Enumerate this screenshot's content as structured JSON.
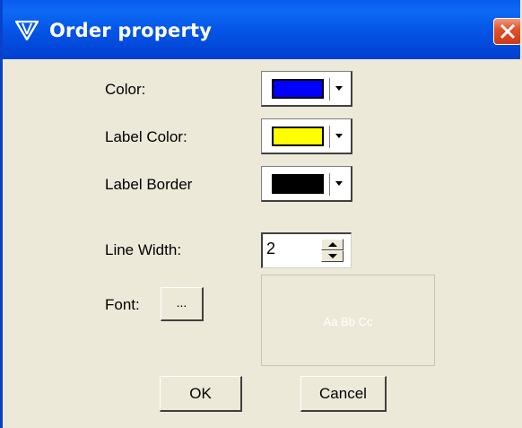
{
  "window": {
    "title": "Order property"
  },
  "colors": {
    "title_bar": "#0453e4",
    "close_button": "#e2522c",
    "dialog_bg": "#ece9d8"
  },
  "icons": {
    "app": "v-triangle-icon",
    "close": "close-x-icon",
    "dropdown": "chevron-down-icon"
  },
  "fields": {
    "color": {
      "label": "Color:",
      "value": "#0000ff"
    },
    "label_color": {
      "label": "Label Color:",
      "value": "#ffff00"
    },
    "label_border": {
      "label": "Label Border",
      "value": "#000000"
    },
    "line_width": {
      "label": "Line Width:",
      "value": "2"
    },
    "font": {
      "label": "Font:",
      "button_label": "...",
      "preview_text": "Aa Bb Cc"
    }
  },
  "buttons": {
    "ok": "OK",
    "cancel": "Cancel"
  }
}
